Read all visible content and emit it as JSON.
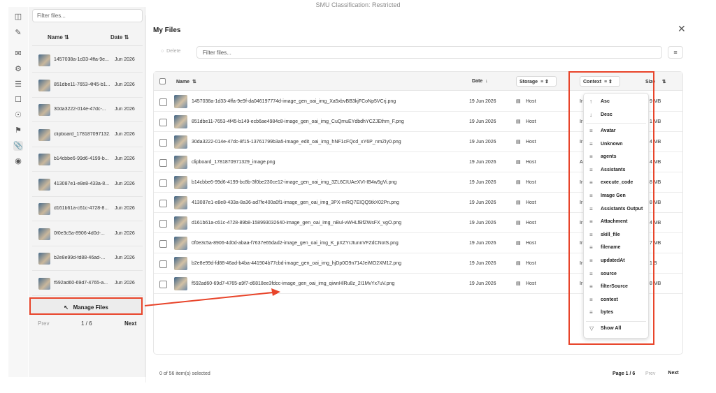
{
  "classification": "SMU Classification: Restricted",
  "sidebar": {
    "filter_placeholder": "Filter files...",
    "col_name": "Name",
    "col_date": "Date",
    "files": [
      {
        "name": "1457038a-1d33-4ffa-9e...",
        "date": "Jun 2026"
      },
      {
        "name": "851dbe11-7653-4f45-b1...",
        "date": "Jun 2026"
      },
      {
        "name": "30da3222-014e-47dc-...",
        "date": "Jun 2026"
      },
      {
        "name": "clipboard_178187097132...",
        "date": "Jun 2026"
      },
      {
        "name": "b14cbbe6-99d6-4199-b...",
        "date": "Jun 2026"
      },
      {
        "name": "413087e1-e8e8-433a-8...",
        "date": "Jun 2026"
      },
      {
        "name": "d161b61a-c61c-4728-8...",
        "date": "Jun 2026"
      },
      {
        "name": "0f0e3c5a-8906-4d0d-...",
        "date": "Jun 2026"
      },
      {
        "name": "b2e8e99d-fd88-46ad-...",
        "date": "Jun 2026"
      },
      {
        "name": "f592ad60-69d7-4765-a...",
        "date": "Jun 2026"
      }
    ],
    "manage_files": "Manage Files",
    "prev": "Prev",
    "page": "1 / 6",
    "next": "Next"
  },
  "modal": {
    "title": "My Files",
    "delete": "Delete",
    "filter_placeholder": "Filter files...",
    "columns": {
      "name": "Name",
      "date": "Date",
      "storage": "Storage",
      "context": "Context",
      "size": "Size"
    },
    "rows": [
      {
        "name": "1457038a-1d33-4ffa-9e9f-da046197774d-image_gen_oai_img_Xa5xbvBB3kjFCoNp5VCrj.png",
        "date": "19 Jun 2026",
        "storage": "Host",
        "context": "Ir",
        "size": "9 MB"
      },
      {
        "name": "851dbe11-7653-4f45-b149-ecb6ae4984c8-image_gen_oai_img_CuQmuEYdbdhYCZJEthm_F.png",
        "date": "19 Jun 2026",
        "storage": "Host",
        "context": "Ir",
        "size": "1 MB"
      },
      {
        "name": "30da3222-014e-47dc-8f15-13761799b3a5-image_edit_oai_img_hNF1cFQcd_xY6P_nmZIy0.png",
        "date": "19 Jun 2026",
        "storage": "Host",
        "context": "Ir",
        "size": "4 MB"
      },
      {
        "name": "clipboard_1781870971329_image.png",
        "date": "19 Jun 2026",
        "storage": "Host",
        "context": "A",
        "size": "4 MB"
      },
      {
        "name": "b14cbbe6-99d6-4199-bc8b-3f0be230ce12-image_gen_oai_img_3ZL6CIUAeXVI-IB4w5gVi.png",
        "date": "19 Jun 2026",
        "storage": "Host",
        "context": "Ir",
        "size": "8 MB"
      },
      {
        "name": "413087e1-e8e8-433a-8a36-ad7fe400a0f1-image_gen_oai_img_3PX-rnRQ7EIQQ5tkX02Pn.png",
        "date": "19 Jun 2026",
        "storage": "Host",
        "context": "Ir",
        "size": "8 MB"
      },
      {
        "name": "d161b61a-c61c-4728-89b8-158993032640-image_gen_oai_img_nBul-vWHLfBfZWsFX_vgO.png",
        "date": "19 Jun 2026",
        "storage": "Host",
        "context": "Ir",
        "size": "4 MB"
      },
      {
        "name": "0f0e3c5a-8906-4d0d-abaa-f7637e65dad2-image_gen_oai_img_K_pXZYrJtunnVFZdCNotS.png",
        "date": "19 Jun 2026",
        "storage": "Host",
        "context": "Ir",
        "size": "7 MB"
      },
      {
        "name": "b2e8e99d-fd88-46ad-b4ba-441904b77cbd-image_gen_oai_img_hjDp0O9n714JeiMO2XM12.png",
        "date": "19 Jun 2026",
        "storage": "Host",
        "context": "Ir",
        "size": "1 B"
      },
      {
        "name": "f592ad60-69d7-4765-a9f7-d6818ee3fdcc-image_gen_oai_img_qiwnHlRu8z_2I1MvYx7uV.png",
        "date": "19 Jun 2026",
        "storage": "Host",
        "context": "Ir",
        "size": "8 MB"
      }
    ],
    "selected": "0 of 56 item(s) selected",
    "page": "Page 1 / 6",
    "prev": "Prev",
    "next": "Next"
  },
  "context_menu": {
    "sort": [
      {
        "label": "Asc",
        "icon": "arrow-up-icon"
      },
      {
        "label": "Desc",
        "icon": "arrow-down-icon"
      }
    ],
    "filters": [
      "Avatar",
      "Unknown",
      "agents",
      "Assistants",
      "execute_code",
      "Image Gen",
      "Assistants Output",
      "Attachment",
      "skill_file",
      "filename",
      "updatedAt",
      "source",
      "filterSource",
      "context",
      "bytes"
    ],
    "show_all": "Show All"
  },
  "colors": {
    "highlight": "#e8442a"
  }
}
